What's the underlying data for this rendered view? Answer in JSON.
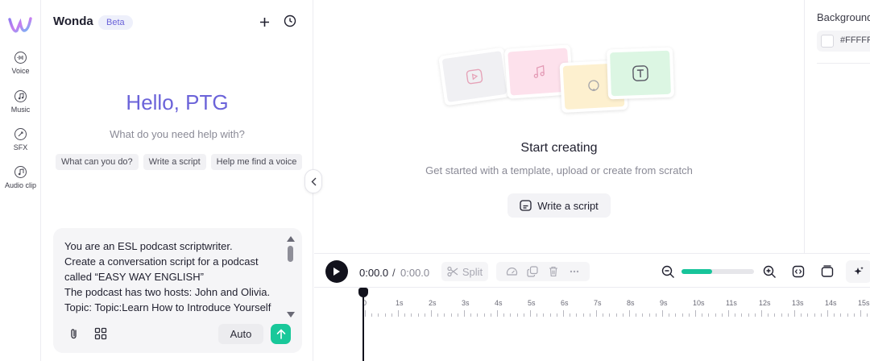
{
  "rail": {
    "items": [
      {
        "label": "Voice",
        "icon": "voice-icon"
      },
      {
        "label": "Music",
        "icon": "music-icon"
      },
      {
        "label": "SFX",
        "icon": "sfx-icon"
      },
      {
        "label": "Audio clip",
        "icon": "audio-clip-icon"
      }
    ]
  },
  "chat": {
    "app_name": "Wonda",
    "badge": "Beta",
    "greeting": "Hello, PTG",
    "subtitle": "What do you need help with?",
    "suggestions": [
      "What can you do?",
      "Write a script",
      "Help me find a voice"
    ],
    "composer_text": "You are an ESL podcast scriptwriter.\nCreate a conversation script for a podcast called “EASY WAY ENGLISH”\nThe podcast has two hosts: John and Olivia.\nTopic: Topic:Learn How to Introduce Yourself in English | Easy Business Conversation",
    "auto_label": "Auto"
  },
  "main": {
    "title": "Start creating",
    "subtitle": "Get started with a template, upload or create from scratch",
    "write_button": "Write a script"
  },
  "right_panel": {
    "label": "Background",
    "color_value": "#FFFFFF",
    "color": "#FFFFFF"
  },
  "timeline": {
    "current_time": "0:00.0",
    "separator": "/",
    "total_time": "0:00.0",
    "split_label": "Split",
    "zoom_level": 0.42,
    "ticks": [
      "0",
      "1s",
      "2s",
      "3s",
      "4s",
      "5s",
      "6s",
      "7s",
      "8s",
      "9s",
      "10s",
      "11s",
      "12s",
      "13s",
      "14s",
      "15s"
    ]
  },
  "colors": {
    "accent": "#6B63D9",
    "send": "#19C89A",
    "zoom": "#17C49A"
  }
}
